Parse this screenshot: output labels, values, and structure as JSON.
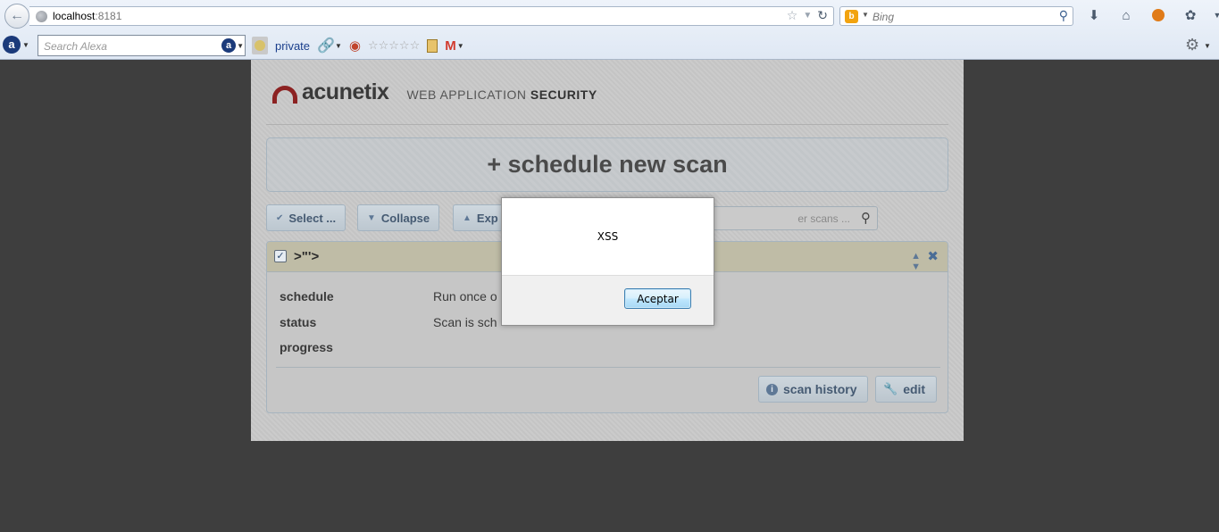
{
  "browser": {
    "url_host": "localhost",
    "url_port": ":8181",
    "search_engine": "Bing",
    "alexa_placeholder": "Search Alexa",
    "private_label": "private"
  },
  "page": {
    "logo_text": "acunetix",
    "logo_tag_light": "WEB APPLICATION ",
    "logo_tag_bold": "SECURITY",
    "new_scan_label": "+ schedule new scan",
    "buttons": {
      "select": "Select ...",
      "collapse": "Collapse",
      "expand": "Exp"
    },
    "filter_placeholder": "er scans ...",
    "scan_card": {
      "title": ">\"'>",
      "rows": [
        {
          "key": "schedule",
          "value": "Run once o"
        },
        {
          "key": "status",
          "value": "Scan is sch"
        },
        {
          "key": "progress",
          "value": ""
        }
      ],
      "scan_history_label": "scan history",
      "edit_label": "edit"
    }
  },
  "dialog": {
    "message": "XSS",
    "button_label": "Aceptar"
  },
  "colors": {
    "backdrop": "#3e3e3e",
    "brand_red": "#8c2222",
    "accent_blue": "#455a72"
  }
}
